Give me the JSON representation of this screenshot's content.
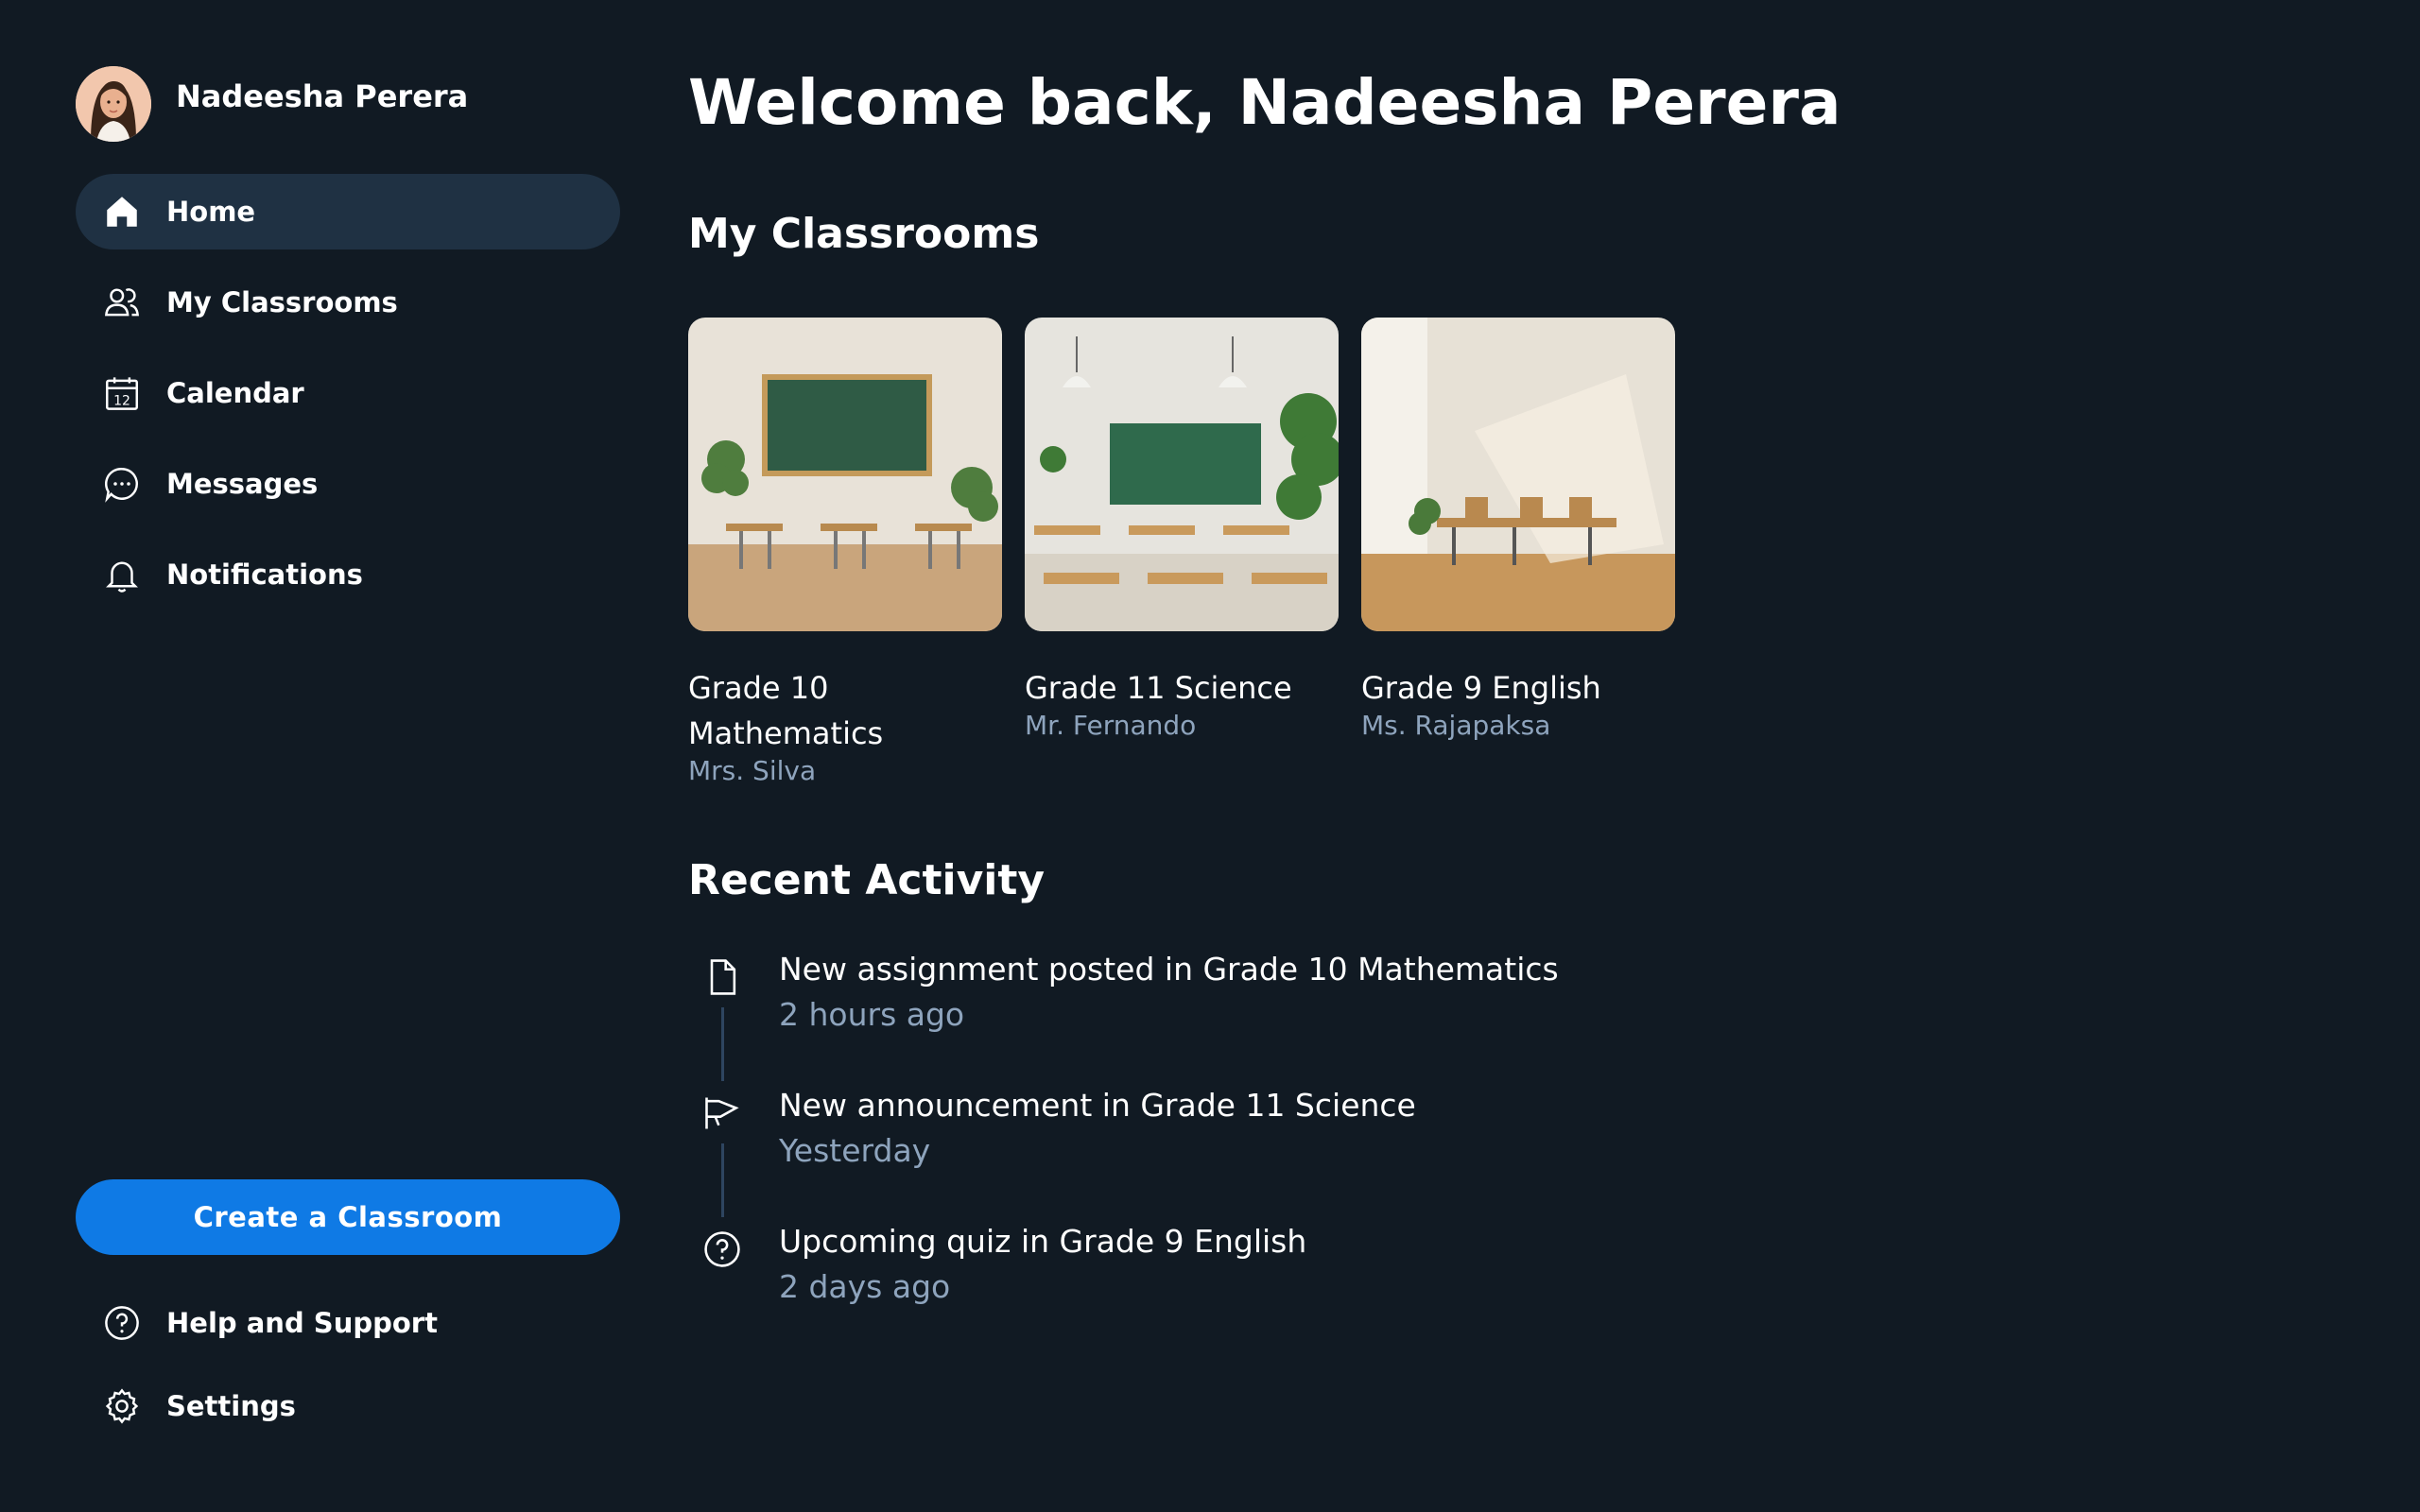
{
  "user": {
    "name": "Nadeesha Perera"
  },
  "nav": {
    "items": [
      {
        "label": "Home",
        "icon": "home-icon",
        "active": true
      },
      {
        "label": "My Classrooms",
        "icon": "users-icon",
        "active": false
      },
      {
        "label": "Calendar",
        "icon": "calendar-icon",
        "active": false
      },
      {
        "label": "Messages",
        "icon": "chat-icon",
        "active": false
      },
      {
        "label": "Notifications",
        "icon": "bell-icon",
        "active": false
      }
    ],
    "calendar_day": "12"
  },
  "create_button": "Create a Classroom",
  "bottom_nav": [
    {
      "label": "Help and Support",
      "icon": "help-icon"
    },
    {
      "label": "Settings",
      "icon": "gear-icon"
    }
  ],
  "main": {
    "welcome": "Welcome back, Nadeesha Perera",
    "classrooms_title": "My Classrooms",
    "activity_title": "Recent Activity"
  },
  "classrooms": [
    {
      "title": "Grade 10 Mathematics",
      "teacher": "Mrs. Silva"
    },
    {
      "title": "Grade 11 Science",
      "teacher": "Mr. Fernando"
    },
    {
      "title": "Grade 9 English",
      "teacher": "Ms. Rajapaksa"
    }
  ],
  "activity": [
    {
      "text": "New assignment posted in Grade 10 Mathematics",
      "time": "2 hours ago",
      "icon": "document-icon"
    },
    {
      "text": "New announcement in Grade 11 Science",
      "time": "Yesterday",
      "icon": "megaphone-icon"
    },
    {
      "text": "Upcoming quiz in Grade 9 English",
      "time": "2 days ago",
      "icon": "question-icon"
    }
  ],
  "colors": {
    "background": "#111a23",
    "active_nav": "#1f3143",
    "primary": "#0f7ae5",
    "muted_text": "#8ea4bd"
  }
}
